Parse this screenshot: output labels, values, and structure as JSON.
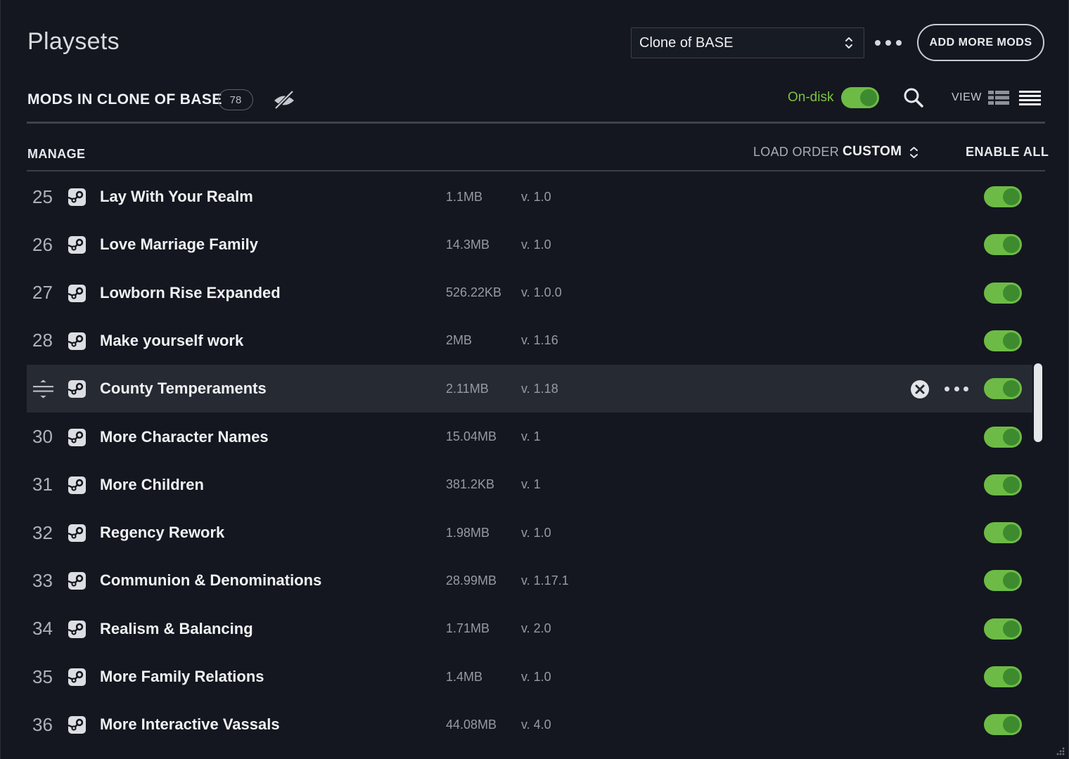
{
  "header": {
    "title": "Playsets",
    "playset_select": {
      "value": "Clone of BASE"
    },
    "add_mods_label": "ADD MORE MODS"
  },
  "mods_header": {
    "title": "MODS IN CLONE OF BASE",
    "count": "78",
    "ondisk_label": "On-disk",
    "ondisk_enabled": true,
    "view_label": "VIEW"
  },
  "manage_bar": {
    "manage_label": "MANAGE",
    "load_order_label": "LOAD ORDER",
    "sort_value": "CUSTOM",
    "enable_all_label": "ENABLE ALL"
  },
  "colors": {
    "background": "#14171f",
    "accent_green": "#6dbb46",
    "hover_row": "#262a33"
  },
  "mods": [
    {
      "index": "25",
      "name": "Lay With Your Realm",
      "size": "1.1MB",
      "version": "v. 1.0",
      "enabled": true,
      "source_icon": "steam-icon"
    },
    {
      "index": "26",
      "name": "Love Marriage Family",
      "size": "14.3MB",
      "version": "v. 1.0",
      "enabled": true,
      "source_icon": "steam-icon"
    },
    {
      "index": "27",
      "name": "Lowborn Rise Expanded",
      "size": "526.22KB",
      "version": "v. 1.0.0",
      "enabled": true,
      "source_icon": "steam-icon"
    },
    {
      "index": "28",
      "name": "Make yourself work",
      "size": "2MB",
      "version": "v. 1.16",
      "enabled": true,
      "source_icon": "steam-icon"
    },
    {
      "index": "",
      "name": "County Temperaments",
      "size": "2.11MB",
      "version": "v. 1.18",
      "enabled": true,
      "hovered": true,
      "source_icon": "steam-icon"
    },
    {
      "index": "30",
      "name": "More Character Names",
      "size": "15.04MB",
      "version": "v. 1",
      "enabled": true,
      "source_icon": "steam-icon"
    },
    {
      "index": "31",
      "name": "More Children",
      "size": "381.2KB",
      "version": "v. 1",
      "enabled": true,
      "source_icon": "steam-icon"
    },
    {
      "index": "32",
      "name": "Regency Rework",
      "size": "1.98MB",
      "version": "v. 1.0",
      "enabled": true,
      "source_icon": "steam-icon"
    },
    {
      "index": "33",
      "name": "Communion & Denominations",
      "size": "28.99MB",
      "version": "v. 1.17.1",
      "enabled": true,
      "source_icon": "steam-icon"
    },
    {
      "index": "34",
      "name": "Realism & Balancing",
      "size": "1.71MB",
      "version": "v. 2.0",
      "enabled": true,
      "source_icon": "steam-icon"
    },
    {
      "index": "35",
      "name": "More Family Relations",
      "size": "1.4MB",
      "version": "v. 1.0",
      "enabled": true,
      "source_icon": "steam-icon"
    },
    {
      "index": "36",
      "name": "More Interactive Vassals",
      "size": "44.08MB",
      "version": "v. 4.0",
      "enabled": true,
      "source_icon": "steam-icon"
    }
  ]
}
